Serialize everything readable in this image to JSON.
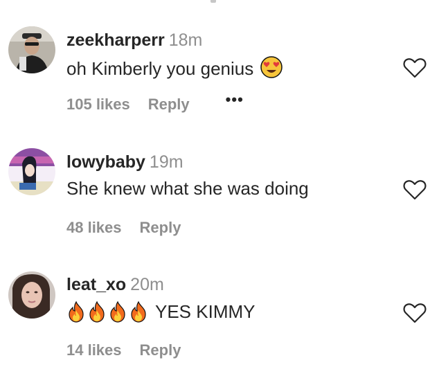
{
  "comments": [
    {
      "username": "zeekharperr",
      "time": "18m",
      "text": "oh Kimberly you genius",
      "emoji": "heart-eyes-emoji",
      "likes": "105 likes",
      "reply": "Reply",
      "more": "•••"
    },
    {
      "username": "lowybaby",
      "time": "19m",
      "text": "She knew what she was doing",
      "likes": "48 likes",
      "reply": "Reply"
    },
    {
      "username": "leat_xo",
      "time": "20m",
      "emoji_prefix": "fire-emoji x4",
      "text": "YES KIMMY",
      "likes": "14 likes",
      "reply": "Reply"
    }
  ],
  "colors": {
    "text": "#262626",
    "secondary": "#8e8e8e",
    "background": "#ffffff"
  }
}
